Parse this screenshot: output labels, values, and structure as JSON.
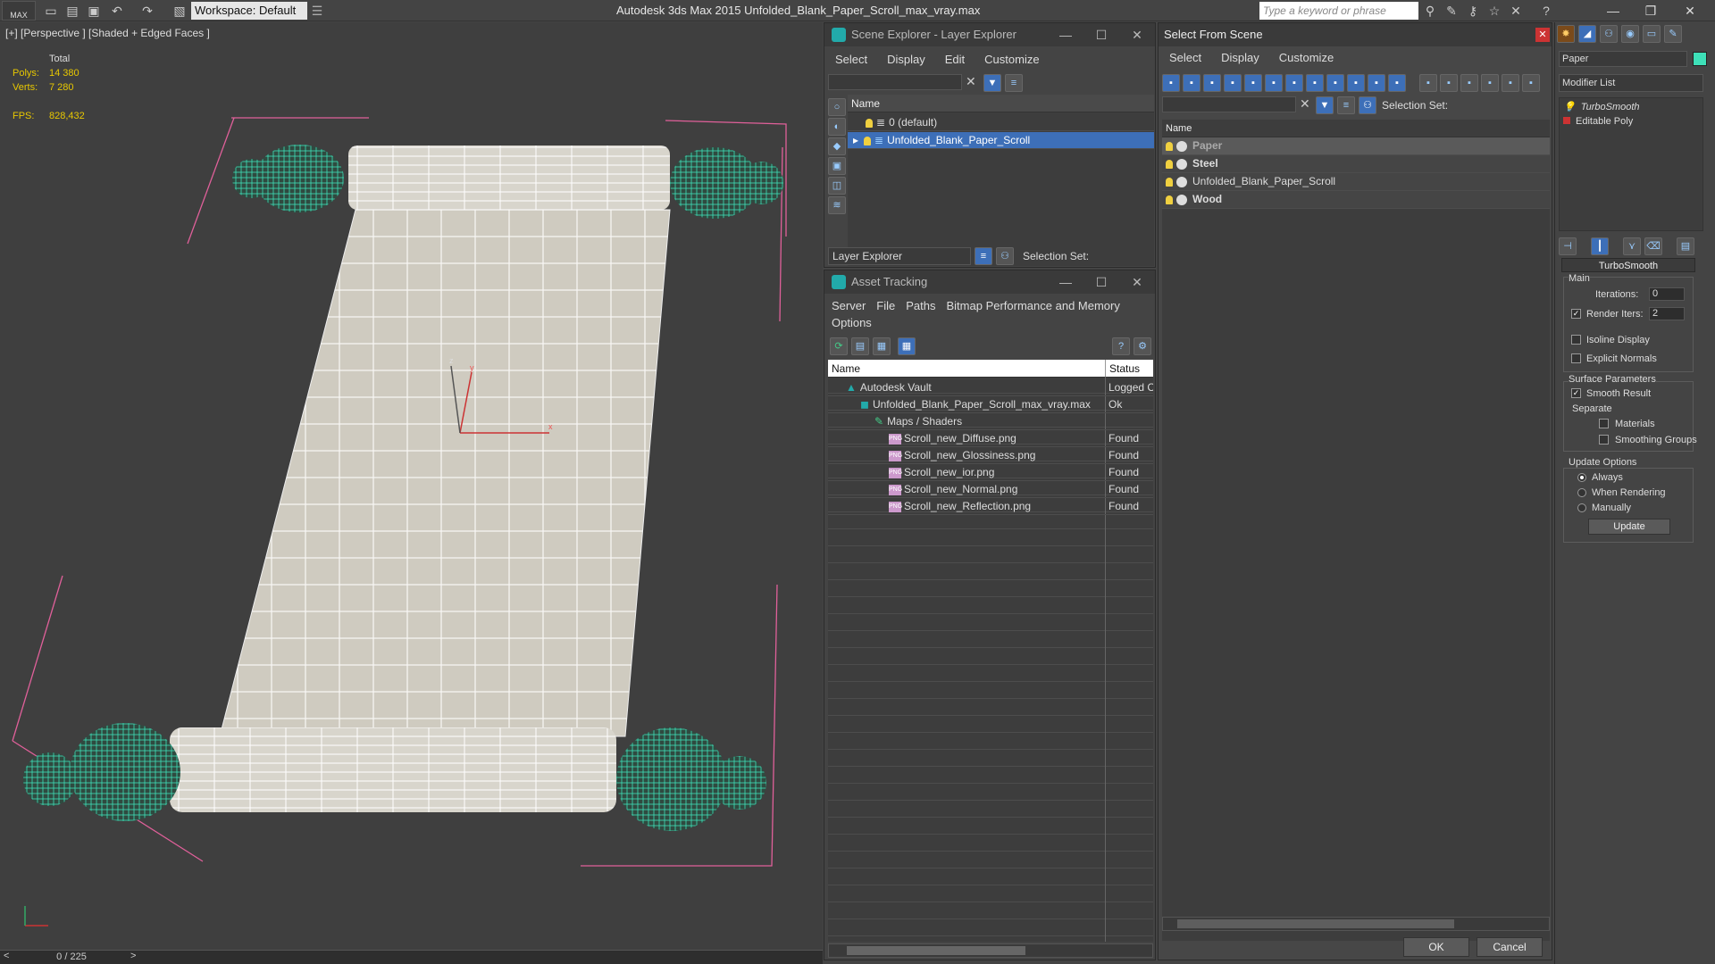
{
  "app": {
    "logo": "MAX",
    "workspace": "Workspace: Default",
    "title": "Autodesk 3ds Max  2015    Unfolded_Blank_Paper_Scroll_max_vray.max",
    "search_placeholder": "Type a keyword or phrase"
  },
  "viewport": {
    "label": "[+] [Perspective ] [Shaded + Edged Faces ]",
    "stats": {
      "total_label": "Total",
      "polys_label": "Polys:",
      "polys": "14 380",
      "verts_label": "Verts:",
      "verts": "7 280",
      "fps_label": "FPS:",
      "fps": "828,432"
    },
    "axis_x": "x",
    "axis_y": "y",
    "axis_z": "z",
    "frame": "0 / 225"
  },
  "scene_explorer": {
    "title": "Scene Explorer - Layer Explorer",
    "menu": [
      "Select",
      "Display",
      "Edit",
      "Customize"
    ],
    "col_name": "Name",
    "rows": [
      {
        "label": "0 (default)",
        "selected": false
      },
      {
        "label": "Unfolded_Blank_Paper_Scroll",
        "selected": true
      }
    ],
    "footer_combo": "Layer Explorer",
    "footer_selset": "Selection Set:"
  },
  "asset_tracking": {
    "title": "Asset Tracking",
    "menu1": [
      "Server",
      "File",
      "Paths",
      "Bitmap Performance and Memory"
    ],
    "menu2": [
      "Options"
    ],
    "col_name": "Name",
    "col_status": "Status",
    "rows": [
      {
        "name": "Autodesk Vault",
        "status": "Logged C",
        "indent": 0,
        "icon": "vault"
      },
      {
        "name": "Unfolded_Blank_Paper_Scroll_max_vray.max",
        "status": "Ok",
        "indent": 1,
        "icon": "max"
      },
      {
        "name": "Maps / Shaders",
        "status": "",
        "indent": 2,
        "icon": "maps"
      },
      {
        "name": "Scroll_new_Diffuse.png",
        "status": "Found",
        "indent": 3,
        "icon": "png"
      },
      {
        "name": "Scroll_new_Glossiness.png",
        "status": "Found",
        "indent": 3,
        "icon": "png"
      },
      {
        "name": "Scroll_new_ior.png",
        "status": "Found",
        "indent": 3,
        "icon": "png"
      },
      {
        "name": "Scroll_new_Normal.png",
        "status": "Found",
        "indent": 3,
        "icon": "png"
      },
      {
        "name": "Scroll_new_Reflection.png",
        "status": "Found",
        "indent": 3,
        "icon": "png"
      }
    ],
    "png_tag": "PNG"
  },
  "select_from_scene": {
    "title": "Select From Scene",
    "menu": [
      "Select",
      "Display",
      "Customize"
    ],
    "selset": "Selection Set:",
    "col_name": "Name",
    "rows": [
      {
        "label": "Paper",
        "bold": true,
        "selected": true
      },
      {
        "label": "Steel",
        "bold": true,
        "selected": false
      },
      {
        "label": "Unfolded_Blank_Paper_Scroll",
        "bold": false,
        "selected": false
      },
      {
        "label": "Wood",
        "bold": true,
        "selected": false
      }
    ],
    "ok": "OK",
    "cancel": "Cancel"
  },
  "command_panel": {
    "object_name": "Paper",
    "modifier_list": "Modifier List",
    "stack": [
      "TurboSmooth",
      "Editable Poly"
    ],
    "turbosmooth": {
      "header": "TurboSmooth",
      "main": "Main",
      "iterations_label": "Iterations:",
      "iterations": "0",
      "render_iters_label": "Render Iters:",
      "render_iters": "2",
      "render_iters_checked": true,
      "isoline": "Isoline Display",
      "explicit_normals": "Explicit Normals",
      "surface_params": "Surface Parameters",
      "smooth_result": "Smooth Result",
      "separate": "Separate",
      "materials": "Materials",
      "smoothing_groups": "Smoothing Groups",
      "update_options": "Update Options",
      "always": "Always",
      "when_rendering": "When Rendering",
      "manually": "Manually",
      "update": "Update"
    }
  },
  "colors": {
    "selected_row": "#3d6fb8",
    "wire_cyan": "#3ee0b8",
    "paper": "#cfcbc0",
    "bbox_pink": "#e0609a"
  }
}
